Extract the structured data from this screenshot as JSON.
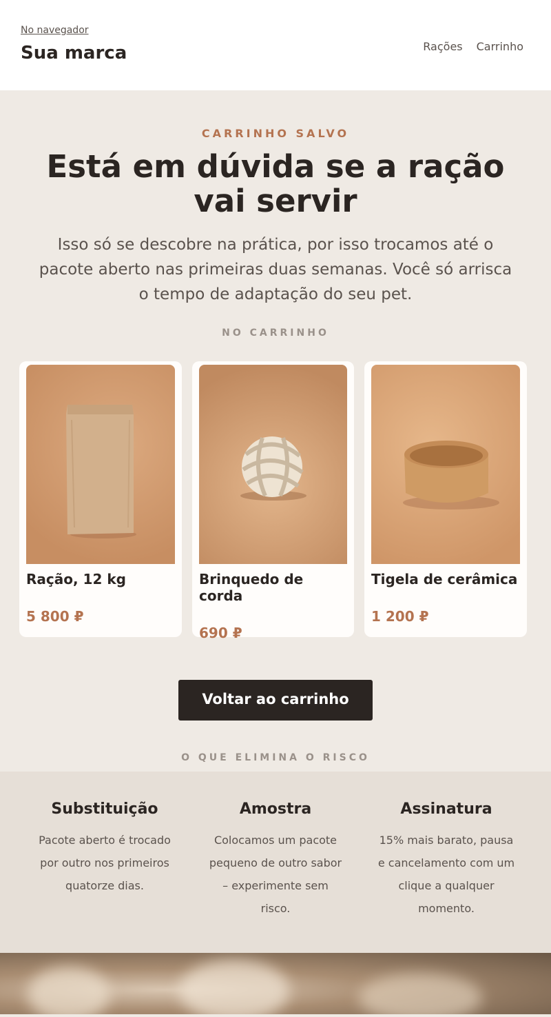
{
  "header": {
    "browser_link": "No navegador",
    "brand": "Sua marca",
    "menu": [
      "Rações",
      "Carrinho"
    ]
  },
  "hero": {
    "eyebrow": "CARRINHO SALVO",
    "title": "Está em dúvida se a ração vai servir",
    "lead": "Isso só se descobre na prática, por isso trocamos até o pacote aberto nas primeiras duas semanas. Você só arrisca o tempo de adaptação do seu pet.",
    "cart_label": "NO CARRINHO"
  },
  "products": [
    {
      "name": "Ração, 12 kg",
      "price": "5 800 ₽",
      "icon": "kraft-bag-image"
    },
    {
      "name": "Brinquedo de corda",
      "price": "690 ₽",
      "icon": "rope-toy-image"
    },
    {
      "name": "Tigela de cerâmica",
      "price": "1 200 ₽",
      "icon": "ceramic-bowl-image"
    }
  ],
  "cta": {
    "label": "Voltar ao carrinho"
  },
  "risk": {
    "label": "O QUE ELIMINA O RISCO",
    "items": [
      {
        "title": "Substituição",
        "text": "Pacote aberto é trocado por outro nos primeiros quatorze dias."
      },
      {
        "title": "Amostra",
        "text": "Colocamos um pacote pequeno de outro sabor – experimente sem risco."
      },
      {
        "title": "Assinatura",
        "text": "15% mais barato, pausa e cancelamento com um clique a qualquer momento."
      }
    ]
  },
  "colors": {
    "accent": "#b47350",
    "dark": "#2b2522",
    "background": "#efeae4",
    "band": "#e6dfd7"
  }
}
